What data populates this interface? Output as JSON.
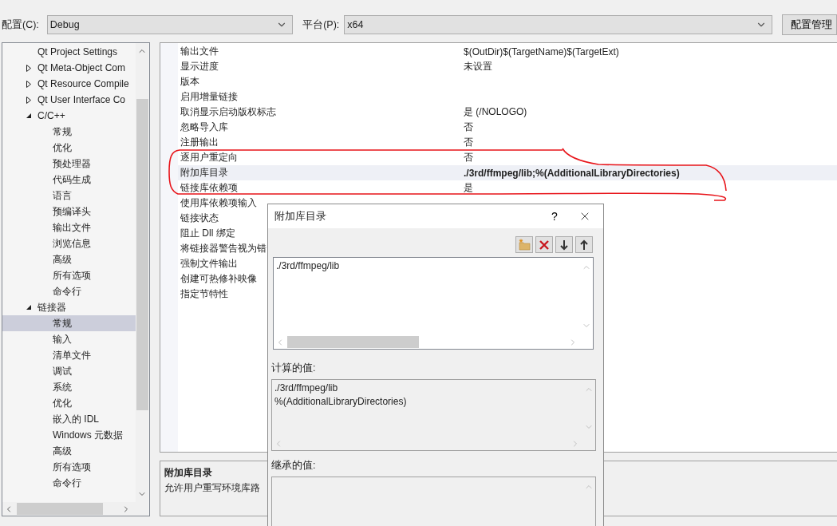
{
  "config_bar": {
    "config_label": "配置(C):",
    "config_value": "Debug",
    "platform_label": "平台(P):",
    "platform_value": "x64",
    "manager_button": "配置管理"
  },
  "tree": [
    {
      "label": "Qt Project Settings",
      "selected": false
    },
    {
      "label": "Qt Meta-Object Com",
      "expanded": false,
      "selected": false
    },
    {
      "label": "Qt Resource Compile",
      "expanded": false,
      "selected": false
    },
    {
      "label": "Qt User Interface Co",
      "expanded": false,
      "selected": false
    },
    {
      "label": "C/C++",
      "expanded": true,
      "selected": false,
      "children": [
        {
          "label": "常规",
          "selected": false
        },
        {
          "label": "优化",
          "selected": false
        },
        {
          "label": "预处理器",
          "selected": false
        },
        {
          "label": "代码生成",
          "selected": false
        },
        {
          "label": "语言",
          "selected": false
        },
        {
          "label": "预编译头",
          "selected": false
        },
        {
          "label": "输出文件",
          "selected": false
        },
        {
          "label": "浏览信息",
          "selected": false
        },
        {
          "label": "高级",
          "selected": false
        },
        {
          "label": "所有选项",
          "selected": false
        },
        {
          "label": "命令行",
          "selected": false
        }
      ]
    },
    {
      "label": "链接器",
      "expanded": true,
      "selected": false,
      "children": [
        {
          "label": "常规",
          "selected": true
        },
        {
          "label": "输入",
          "selected": false
        },
        {
          "label": "清单文件",
          "selected": false
        },
        {
          "label": "调试",
          "selected": false
        },
        {
          "label": "系统",
          "selected": false
        },
        {
          "label": "优化",
          "selected": false
        },
        {
          "label": "嵌入的 IDL",
          "selected": false
        },
        {
          "label": "Windows 元数据",
          "selected": false
        },
        {
          "label": "高级",
          "selected": false
        },
        {
          "label": "所有选项",
          "selected": false
        },
        {
          "label": "命令行",
          "selected": false
        }
      ]
    }
  ],
  "properties": [
    {
      "name": "输出文件",
      "value": "$(OutDir)$(TargetName)$(TargetExt)",
      "selected": false,
      "modified": false
    },
    {
      "name": "显示进度",
      "value": "未设置",
      "selected": false,
      "modified": false
    },
    {
      "name": "版本",
      "selected": false
    },
    {
      "name": "启用增量链接",
      "selected": false
    },
    {
      "name": "取消显示启动版权标志",
      "value": "是 (/NOLOGO)",
      "selected": false,
      "modified": false
    },
    {
      "name": "忽略导入库",
      "value": "否",
      "selected": false,
      "modified": false
    },
    {
      "name": "注册输出",
      "value": "否",
      "selected": false,
      "modified": false
    },
    {
      "name": "逐用户重定向",
      "value": "否",
      "selected": false,
      "modified": false
    },
    {
      "name": "附加库目录",
      "value": "./3rd/ffmpeg/lib;%(AdditionalLibraryDirectories)",
      "selected": true,
      "modified": true
    },
    {
      "name": "链接库依赖项",
      "value": "是",
      "selected": false,
      "modified": false
    },
    {
      "name": "使用库依赖项输入",
      "selected": false
    },
    {
      "name": "链接状态",
      "selected": false
    },
    {
      "name": "阻止 Dll 绑定",
      "selected": false
    },
    {
      "name": "将链接器警告视为错",
      "selected": false
    },
    {
      "name": "强制文件输出",
      "selected": false
    },
    {
      "name": "创建可热修补映像",
      "selected": false
    },
    {
      "name": "指定节特性",
      "selected": false
    }
  ],
  "description": {
    "title": "附加库目录",
    "text": "允许用户重写环境库路"
  },
  "dialog": {
    "title": "附加库目录",
    "help": "?",
    "entries": [
      "./3rd/ffmpeg/lib"
    ],
    "computed_label": "计算的值:",
    "computed_lines": [
      "./3rd/ffmpeg/lib",
      "%(AdditionalLibraryDirectories)"
    ],
    "inherited_label": "继承的值:"
  }
}
